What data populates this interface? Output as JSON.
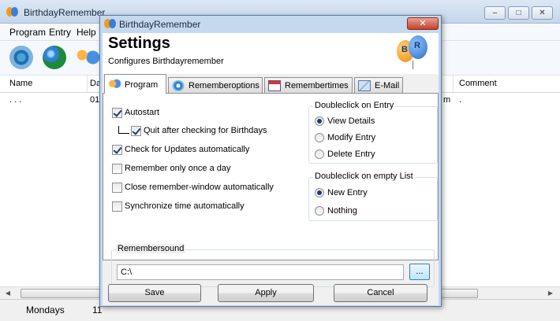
{
  "main": {
    "title": "BirthdayRemember",
    "menu": [
      "Program",
      "Entry",
      "Help"
    ],
    "window_buttons": [
      "–",
      "□",
      "✕"
    ],
    "table": {
      "headers": [
        "Name",
        "Da",
        "Comment"
      ],
      "row": {
        "name": ".    .        .",
        "date": "01",
        "extra": "m",
        "comment": "."
      }
    },
    "status": {
      "mondays": "Mondays",
      "count": "11"
    }
  },
  "dialog": {
    "title": "BirthdayRemember",
    "close_label": "✕",
    "heading": "Settings",
    "subheading": "Configures Birthdayremember",
    "logo_letters": [
      "B",
      "R"
    ],
    "tabs": [
      {
        "label": "Program",
        "icon": "balloons-icon"
      },
      {
        "label": "Rememberoptions",
        "icon": "gear-icon"
      },
      {
        "label": "Remembertimes",
        "icon": "calendar-icon"
      },
      {
        "label": "E-Mail",
        "icon": "mail-icon"
      }
    ],
    "checkboxes": {
      "autostart": {
        "label": "Autostart",
        "checked": true
      },
      "quit_after": {
        "label": "Quit after checking for Birthdays",
        "checked": true
      },
      "check_updates": {
        "label": "Check for Updates automatically",
        "checked": true
      },
      "remember_once": {
        "label": "Remember only once a day",
        "checked": false
      },
      "close_window": {
        "label": "Close remember-window automatically",
        "checked": false
      },
      "sync_time": {
        "label": "Synchronize time automatically",
        "checked": false
      }
    },
    "doubleclick_entry": {
      "title": "Doubleclick on Entry",
      "options": [
        "View Details",
        "Modify Entry",
        "Delete Entry"
      ],
      "selected": "View Details"
    },
    "doubleclick_empty": {
      "title": "Doubleclick on empty List",
      "options": [
        "New Entry",
        "Nothing"
      ],
      "selected": "New Entry"
    },
    "remembersound": {
      "title": "Remembersound",
      "value": "C:\\",
      "browse_label": "..."
    },
    "buttons": {
      "save": "Save",
      "apply": "Apply",
      "cancel": "Cancel"
    }
  }
}
